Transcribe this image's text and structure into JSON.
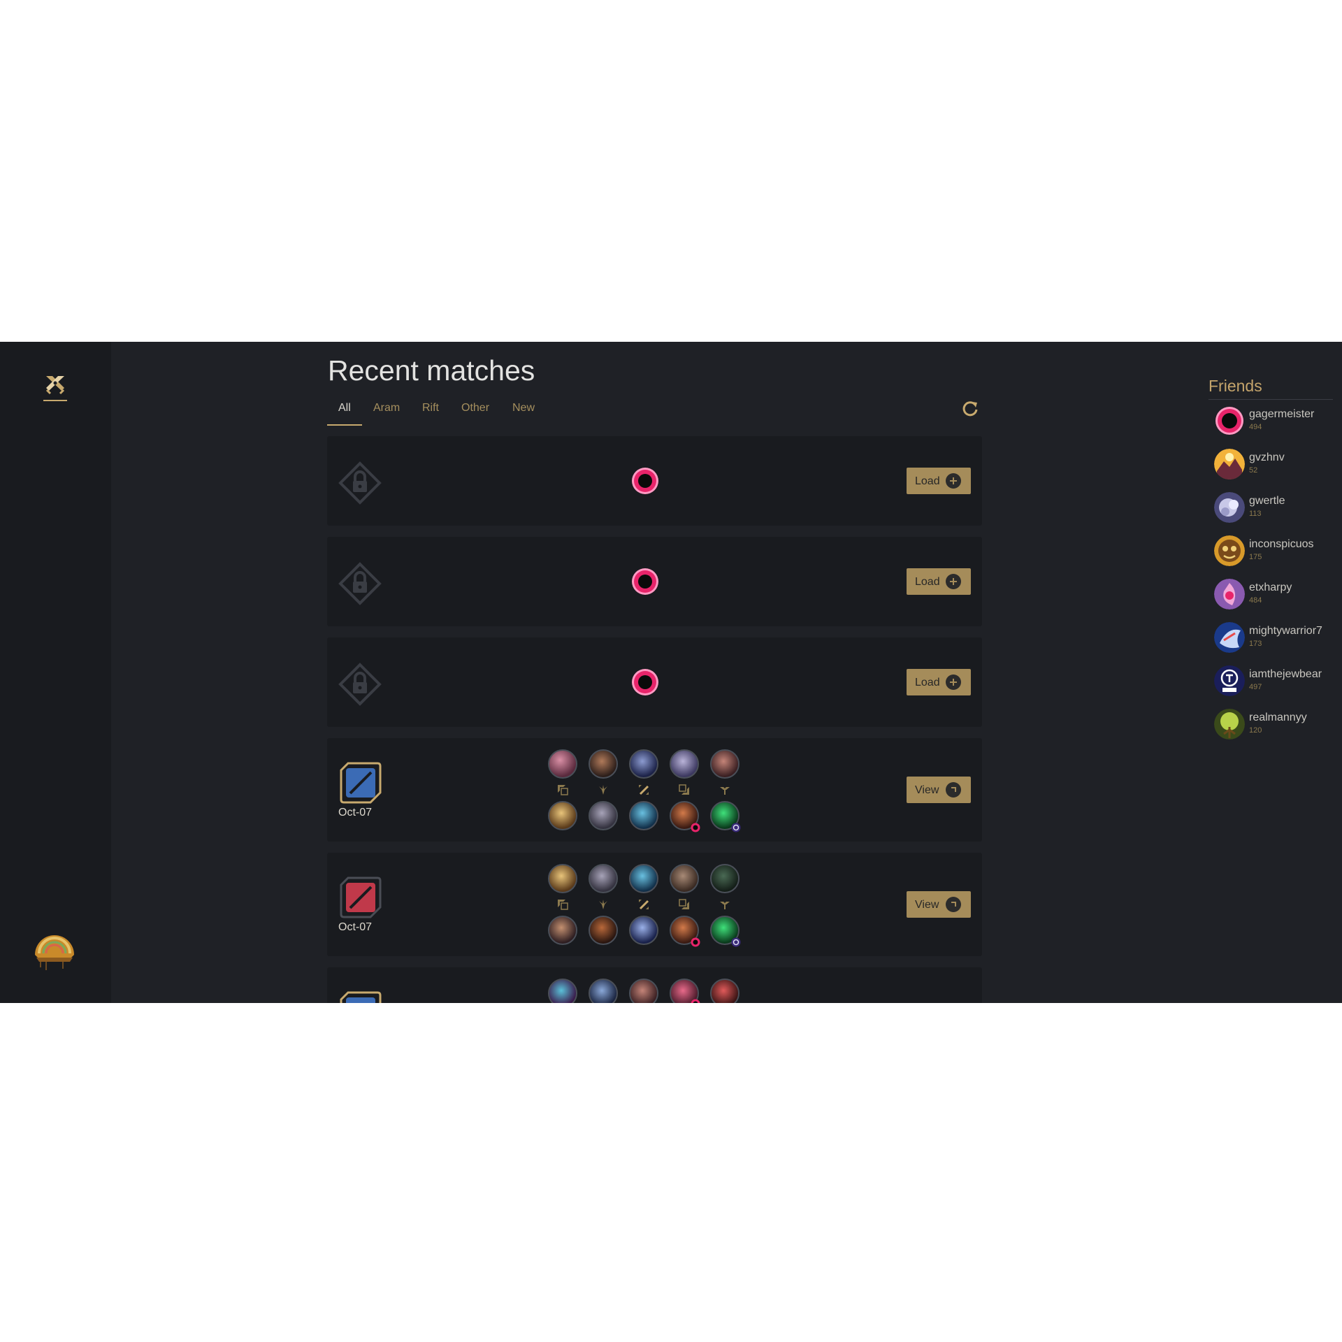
{
  "page": {
    "title": "Recent matches"
  },
  "tabs": [
    {
      "label": "All",
      "active": true
    },
    {
      "label": "Aram"
    },
    {
      "label": "Rift"
    },
    {
      "label": "Other"
    },
    {
      "label": "New"
    }
  ],
  "matches": [
    {
      "state": "locked",
      "button_label": "Load",
      "button_icon": "plus-circle-icon"
    },
    {
      "state": "locked",
      "button_label": "Load",
      "button_icon": "plus-circle-icon"
    },
    {
      "state": "locked",
      "button_label": "Load",
      "button_icon": "plus-circle-icon"
    },
    {
      "state": "loaded",
      "team_color": "#3b6bb5",
      "date": "Oct-07",
      "button_label": "View",
      "button_icon": "arrow-circle-icon"
    },
    {
      "state": "loaded",
      "team_color": "#c0394a",
      "date": "Oct-07",
      "button_label": "View",
      "button_icon": "arrow-circle-icon"
    },
    {
      "state": "loaded",
      "team_color": "#3b6bb5"
    }
  ],
  "friends": {
    "title": "Friends",
    "items": [
      {
        "name": "gagermeister",
        "level": "494"
      },
      {
        "name": "gvzhnv",
        "level": "52"
      },
      {
        "name": "gwertle",
        "level": "113"
      },
      {
        "name": "inconspicuos",
        "level": "175"
      },
      {
        "name": "etxharpy",
        "level": "484"
      },
      {
        "name": "mightywarrior7",
        "level": "173"
      },
      {
        "name": "iamthejewbear",
        "level": "497"
      },
      {
        "name": "realmannyy",
        "level": "120"
      }
    ]
  },
  "colors": {
    "accent_gold": "#c8aa6e",
    "button_gold": "#a58c5a",
    "background": "#1f2126",
    "card": "#191b1f",
    "ring_pink": "#e8246a"
  }
}
